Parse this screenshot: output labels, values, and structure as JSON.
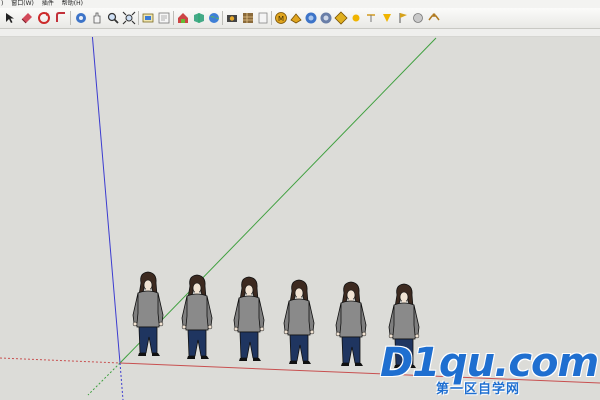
{
  "menu": {
    "items": [
      ")",
      "窗口(W)",
      "插件",
      "帮助(H)"
    ]
  },
  "toolbar": {
    "icons": [
      "select-arrow-icon",
      "eraser-icon",
      "rotate-icon",
      "rect-icon",
      "orbit-icon",
      "pan-icon",
      "zoom-icon",
      "zoom-extents-icon",
      "iso-view-icon",
      "front-view-icon",
      "house-view-icon",
      "globe-icon",
      "component-icon",
      "camera-icon",
      "texture-icon",
      "styles-icon",
      "paint-icon",
      "shadow-icon",
      "fog-icon",
      "dimension-icon",
      "sun-icon",
      "bulb-icon",
      "tape-icon",
      "sphere-icon",
      "walk-icon"
    ]
  },
  "scene": {
    "figures_count": 6,
    "axis_colors": {
      "red": "#c85050",
      "green": "#3fa03f",
      "blue": "#3c3cd0"
    },
    "background": "#dcdcd8"
  },
  "watermark": {
    "main_text": "D1qu.com",
    "sub_text": "第一区自学网"
  }
}
